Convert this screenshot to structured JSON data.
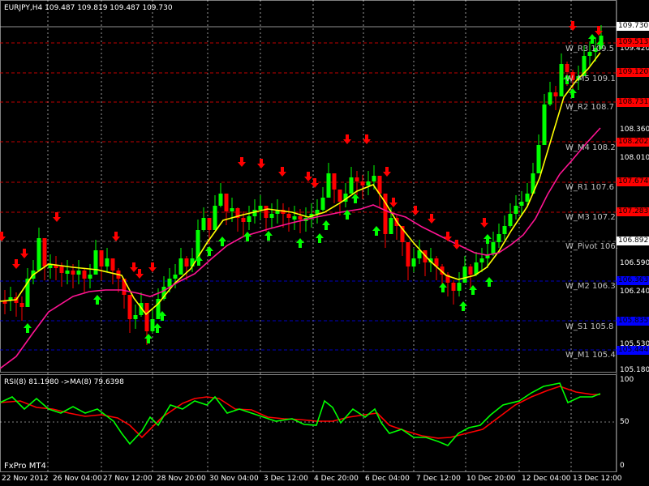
{
  "header": {
    "symbol_line": "EURJPY,H4  109.487 109.819 109.487 109.730",
    "rsi_line": "RSI(8) 81.1980  ->MA(8) 79.6398",
    "watermark": "FxPro MT4"
  },
  "price_axis": {
    "labels": [
      "109.420",
      "108.360",
      "108.010",
      "106.590",
      "106.240",
      "105.530",
      "105.180"
    ],
    "current": "109.730",
    "current_color": "#000000"
  },
  "pivot_levels": [
    {
      "label": "W_R3 109.5",
      "value": "109.513",
      "color": "#ff0000"
    },
    {
      "label": "W_M5 109.1",
      "value": "109.120",
      "color": "#ff0000"
    },
    {
      "label": "W_R2 108.7",
      "value": "108.731",
      "color": "#ff0000"
    },
    {
      "label": "W_M4 108.2",
      "value": "108.202",
      "color": "#ff0000"
    },
    {
      "label": "W_R1 107.6",
      "value": "107.674",
      "color": "#ff0000"
    },
    {
      "label": "W_M3 107.2",
      "value": "107.283",
      "color": "#ff0000"
    },
    {
      "label": "W_Pivot 106.",
      "value": "106.892",
      "color": "#808080"
    },
    {
      "label": "W_M2 106.3",
      "value": "106.363",
      "color": "#0000ff"
    },
    {
      "label": "W_S1 105.8",
      "value": "105.835",
      "color": "#0000ff"
    },
    {
      "label": "W_M1 105.4",
      "value": "105.444",
      "color": "#0000ff"
    }
  ],
  "rsi_axis": [
    "100",
    "50",
    "0"
  ],
  "time_axis": [
    "22 Nov 2012",
    "26 Nov 04:00",
    "27 Nov 12:00",
    "28 Nov 20:00",
    "30 Nov 04:00",
    "3 Dec 12:00",
    "4 Dec 20:00",
    "6 Dec 04:00",
    "7 Dec 12:00",
    "10 Dec 20:00",
    "12 Dec 04:00",
    "13 Dec 12:00"
  ],
  "colors": {
    "bull": "#00ff00",
    "bear": "#ff0000",
    "fast_ma": "#ffff00",
    "slow_ma": "#ff1493",
    "grid": "#ffffff"
  }
}
